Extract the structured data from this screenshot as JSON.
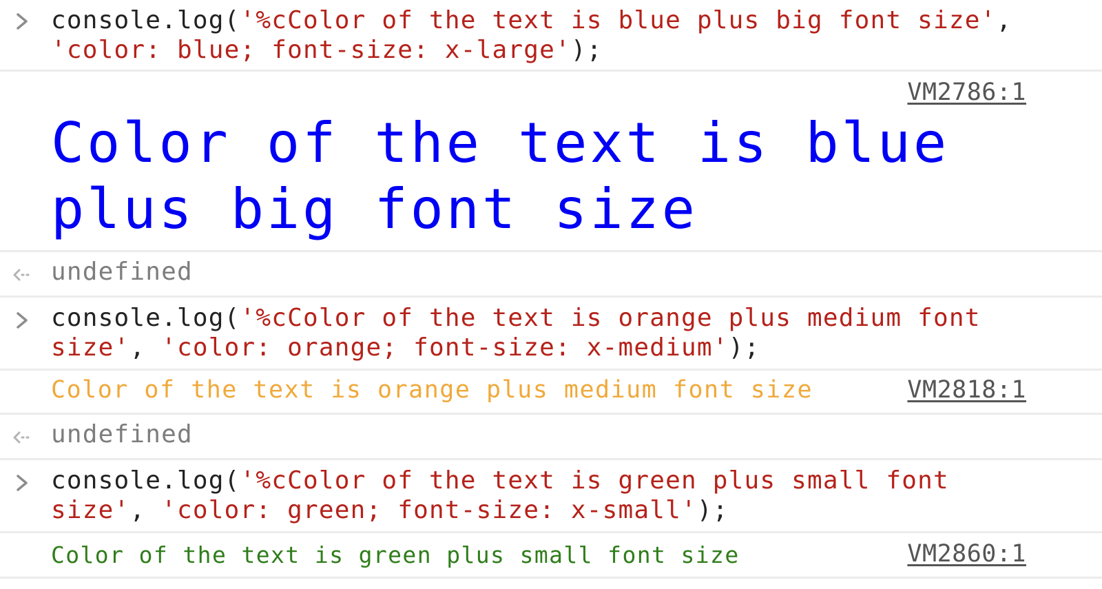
{
  "colors": {
    "string": "#b5221a",
    "blue_output": "#0000f5",
    "orange_output": "#f0a93a",
    "green_output": "#2f7d1a",
    "undefined_text": "#7d7d7d",
    "source_link": "#555555"
  },
  "entries": [
    {
      "type": "input",
      "icon": "prompt-chevron-icon",
      "line1_plain": "console.log(",
      "line1_string": "'%cColor of the text is blue plus big font size'",
      "line1_tail": ",",
      "line2_string": "'color: blue; font-size: x-large'",
      "line2_tail": ");"
    },
    {
      "type": "output",
      "source": "VM2786:1",
      "line1": "Color of the text is blue",
      "line2": "plus big font size"
    },
    {
      "type": "return",
      "icon": "return-arrow-icon",
      "value": "undefined"
    },
    {
      "type": "input",
      "icon": "prompt-chevron-icon",
      "line1_plain": "console.log(",
      "line1_string": "'%cColor of the text is orange plus medium font",
      "line2_string": "size'",
      "line2_mid": ", ",
      "line2_string2": "'color: orange; font-size: x-medium'",
      "line2_tail": ");"
    },
    {
      "type": "output",
      "source": "VM2818:1",
      "text": "Color of the text is orange plus medium font size"
    },
    {
      "type": "return",
      "icon": "return-arrow-icon",
      "value": "undefined"
    },
    {
      "type": "input",
      "icon": "prompt-chevron-icon",
      "line1_plain": "console.log(",
      "line1_string": "'%cColor of the text is green plus small font",
      "line2_string": "size'",
      "line2_mid": ", ",
      "line2_string2": "'color: green; font-size: x-small'",
      "line2_tail": ");"
    },
    {
      "type": "output",
      "source": "VM2860:1",
      "text": "Color of the text is green plus small font size"
    }
  ]
}
